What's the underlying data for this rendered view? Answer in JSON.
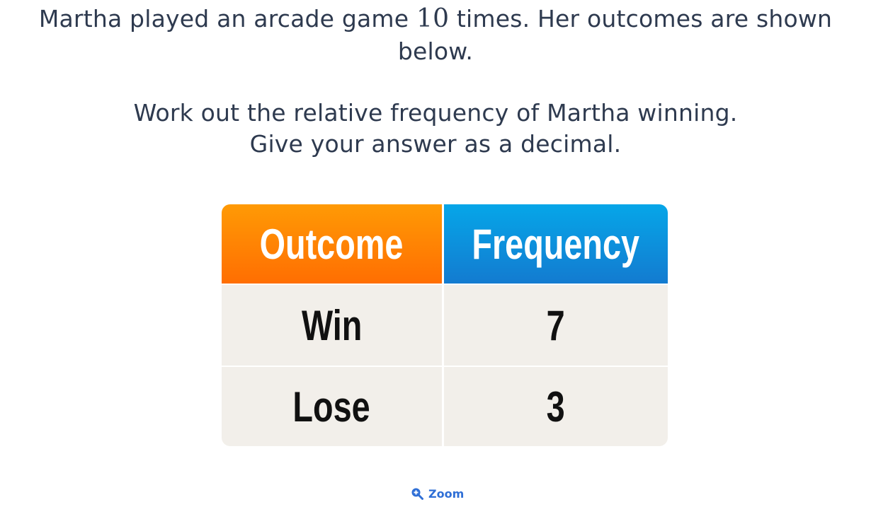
{
  "question": {
    "line1_before": "Martha played an arcade game ",
    "line1_number": "10",
    "line1_after": " times. Her outcomes are shown below.",
    "line2": "Work out the relative frequency of Martha winning.",
    "line3": "Give your answer as a decimal."
  },
  "table": {
    "headers": [
      "Outcome",
      "Frequency"
    ],
    "rows": [
      {
        "outcome": "Win",
        "frequency": "7"
      },
      {
        "outcome": "Lose",
        "frequency": "3"
      }
    ],
    "colors": {
      "outcome_header_top": "#ff9a05",
      "outcome_header_bottom": "#ff6e02",
      "frequency_header_top": "#06a6e8",
      "frequency_header_bottom": "#137bd0",
      "body_background": "#f2efea"
    }
  },
  "zoom": {
    "label": "Zoom",
    "icon": "zoom-in-magnifier-icon",
    "color": "#2f6fd6"
  }
}
